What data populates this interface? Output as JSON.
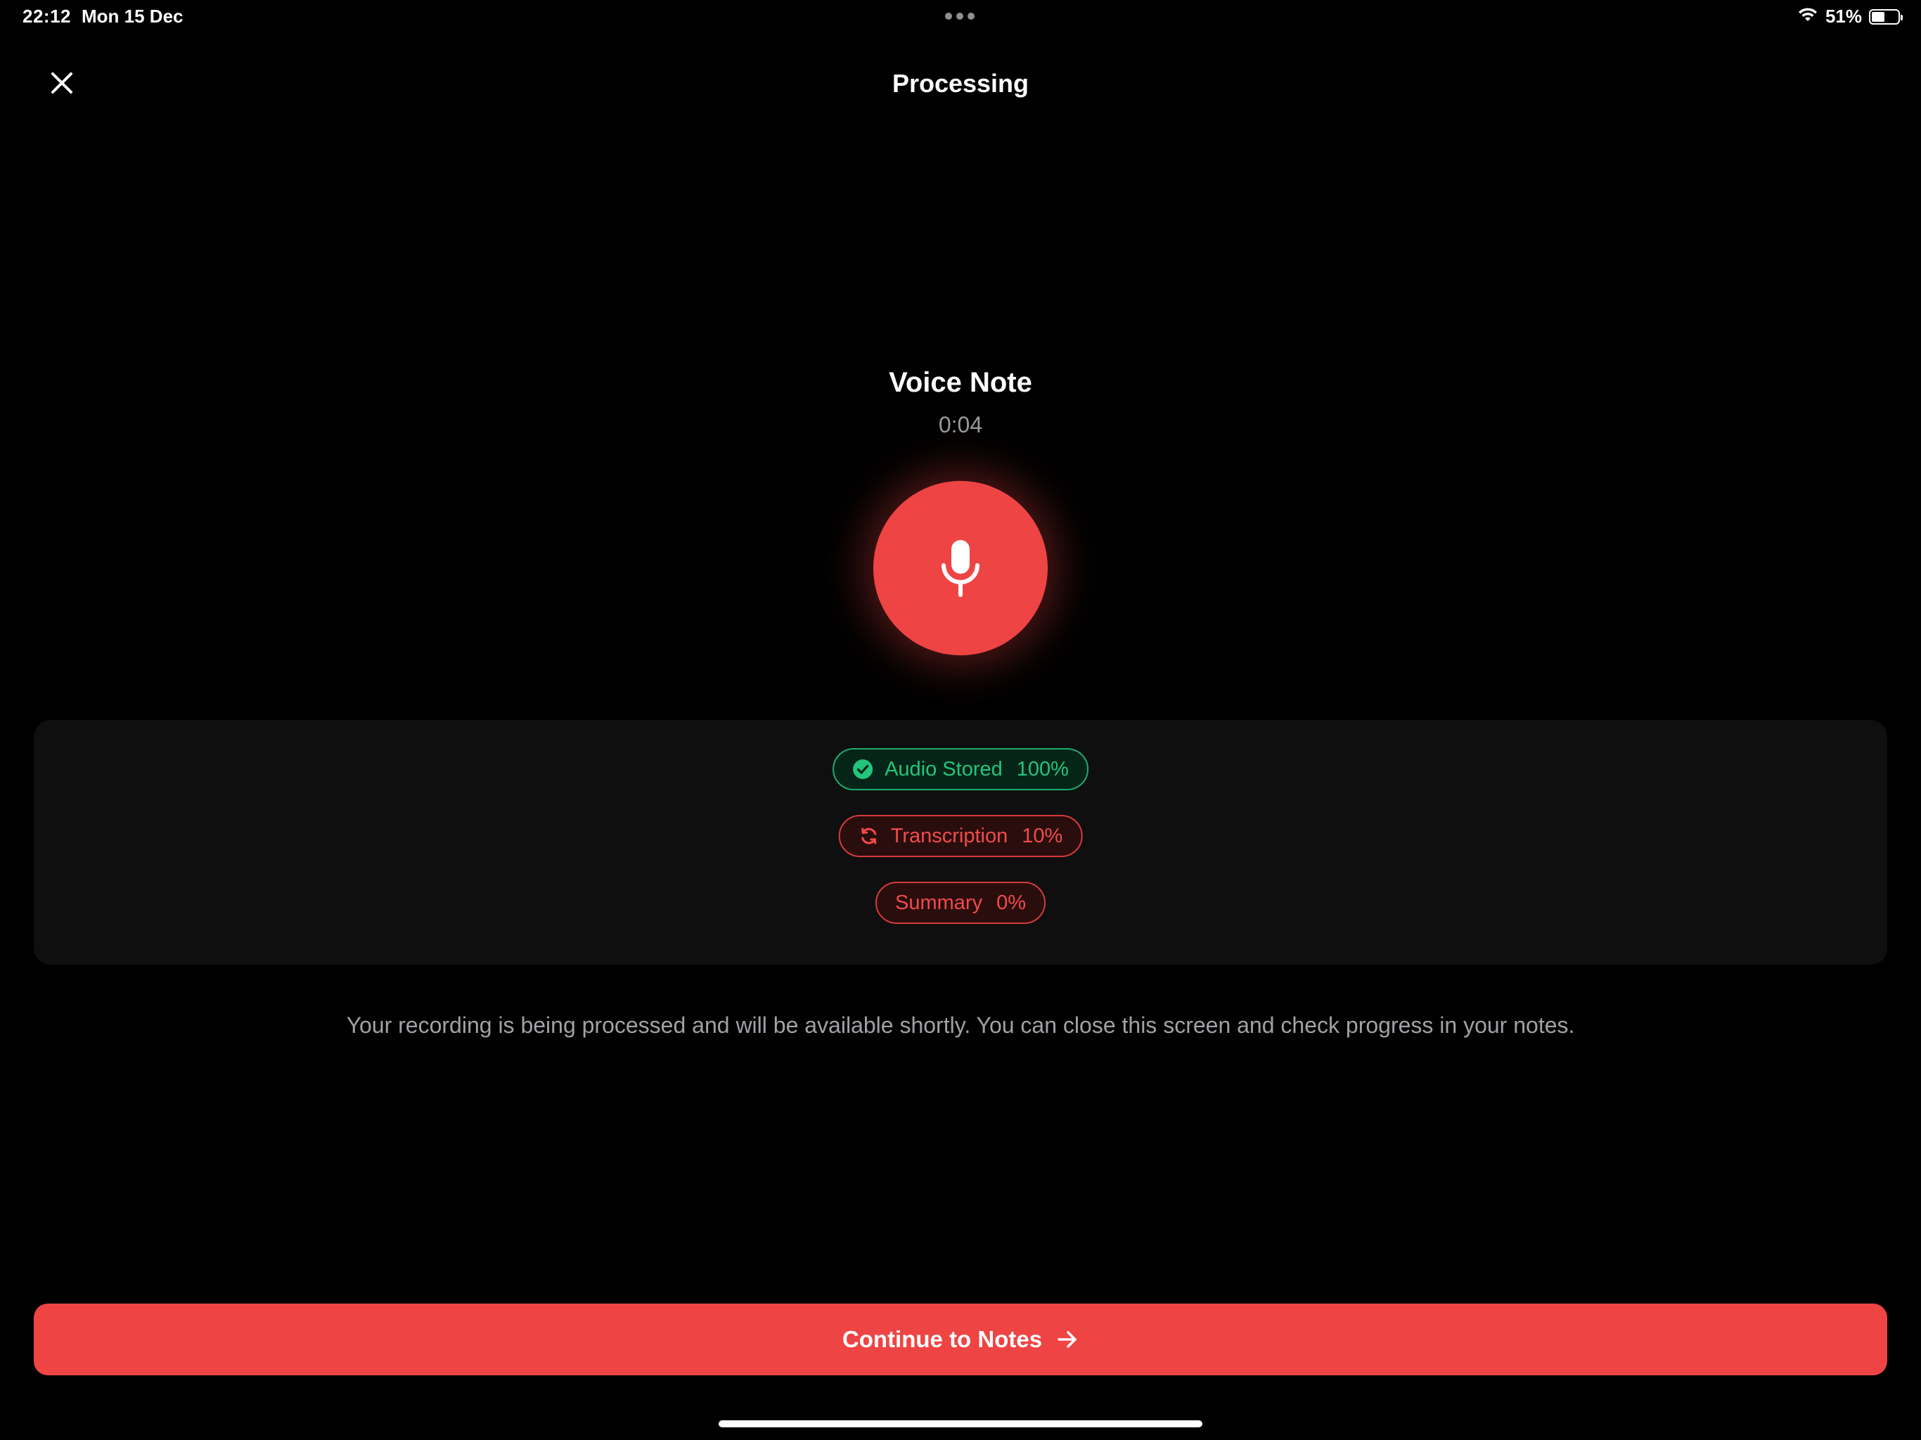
{
  "status_bar": {
    "time": "22:12",
    "date": "Mon 15 Dec",
    "battery_percent": "51%",
    "battery_level": 0.51,
    "wifi_icon": "wifi-icon"
  },
  "nav": {
    "title": "Processing",
    "close_icon": "close-icon"
  },
  "note": {
    "title": "Voice Note",
    "duration": "0:04",
    "mic_icon": "microphone-icon",
    "accent_color": "#ef4444"
  },
  "steps": [
    {
      "label": "Audio Stored",
      "percent": "100%",
      "state": "done",
      "icon": "check-circle-icon",
      "color": "#22c57b"
    },
    {
      "label": "Transcription",
      "percent": "10%",
      "state": "in-progress",
      "icon": "refresh-icon",
      "color": "#f24a4a"
    },
    {
      "label": "Summary",
      "percent": "0%",
      "state": "pending",
      "icon": "",
      "color": "#f24a4a"
    }
  ],
  "info_text": "Your recording is being processed and will be available shortly. You can close this screen and check progress in your notes.",
  "continue_button": {
    "label": "Continue to Notes",
    "icon": "arrow-right-icon"
  }
}
